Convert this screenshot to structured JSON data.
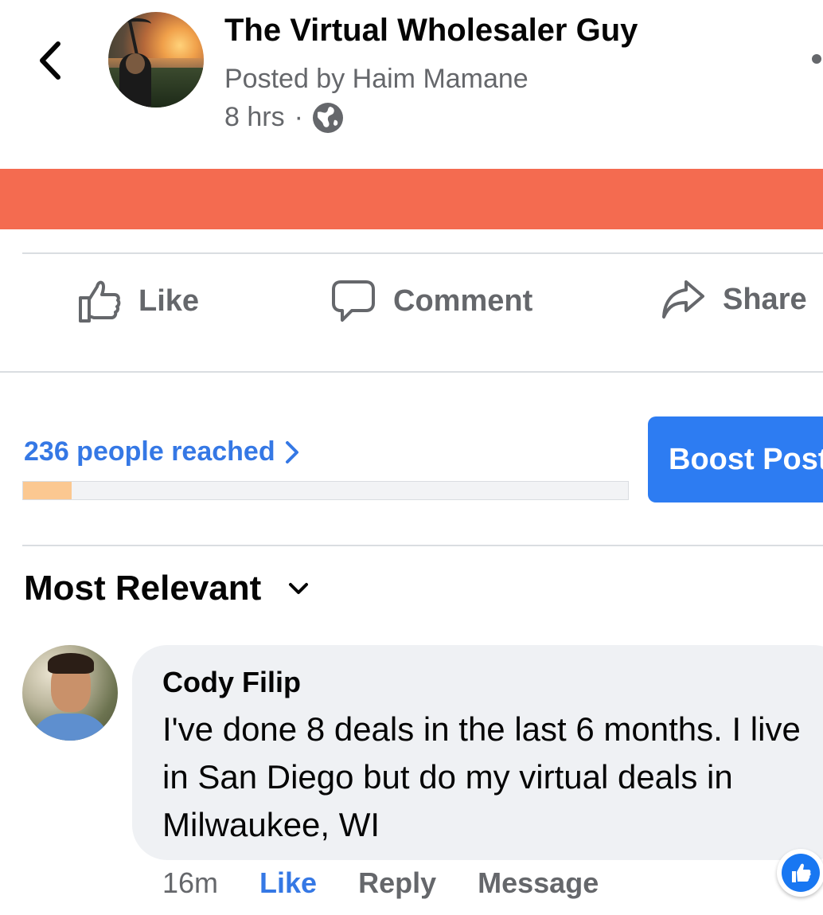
{
  "header": {
    "page_name": "The Virtual Wholesaler Guy",
    "posted_by": "Posted by Haim Mamane",
    "time": "8 hrs",
    "separator": "·",
    "privacy_icon": "globe-icon",
    "back_icon": "chevron-left-icon",
    "more_icon": "more-dots-icon"
  },
  "post": {
    "banner_color": "#f46b50"
  },
  "actions": {
    "like_label": "Like",
    "comment_label": "Comment",
    "share_label": "Share"
  },
  "reach": {
    "label": "236 people reached",
    "progress_fraction": 0.08,
    "boost_label": "Boost Post"
  },
  "comments_sort": {
    "label": "Most Relevant"
  },
  "comments": [
    {
      "author": "Cody Filip",
      "text": "I've done 8 deals in the last 6 months. I live in San Diego but do my virtual deals in Milwaukee, WI",
      "time": "16m",
      "like_label": "Like",
      "reply_label": "Reply",
      "message_label": "Message",
      "reaction": "like-icon"
    }
  ],
  "colors": {
    "accent_blue": "#3578e5",
    "boost_blue": "#2d7cf2",
    "reach_fill": "#fbc891",
    "secondary_text": "#65676b"
  }
}
